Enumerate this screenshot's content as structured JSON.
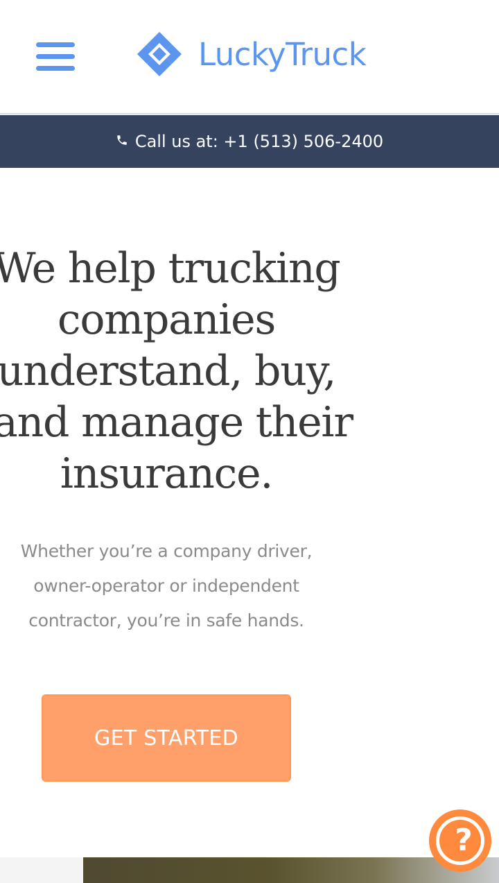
{
  "header": {
    "brand": "LuckyTruck",
    "logo_icon": "luckytruck-logo-icon",
    "menu_icon": "hamburger-menu-icon"
  },
  "callbar": {
    "text": "Call us at: +1 (513) 506-2400",
    "icon": "phone-icon"
  },
  "hero": {
    "title_lines": [
      "We help trucking",
      "companies",
      "understand, buy,",
      "and manage their",
      "insurance."
    ],
    "subtitle_lines": [
      "Whether you’re a company driver,",
      "owner-operator or independent",
      "contractor, you’re in safe hands."
    ],
    "cta_label": "GET STARTED"
  },
  "help_widget": {
    "icon": "help-question-icon",
    "glyph": "?"
  },
  "colors": {
    "brand_blue": "#5b95ee",
    "callbar_bg": "#35435f",
    "cta_orange": "#ffa06b",
    "help_orange": "#ff8a3d"
  }
}
